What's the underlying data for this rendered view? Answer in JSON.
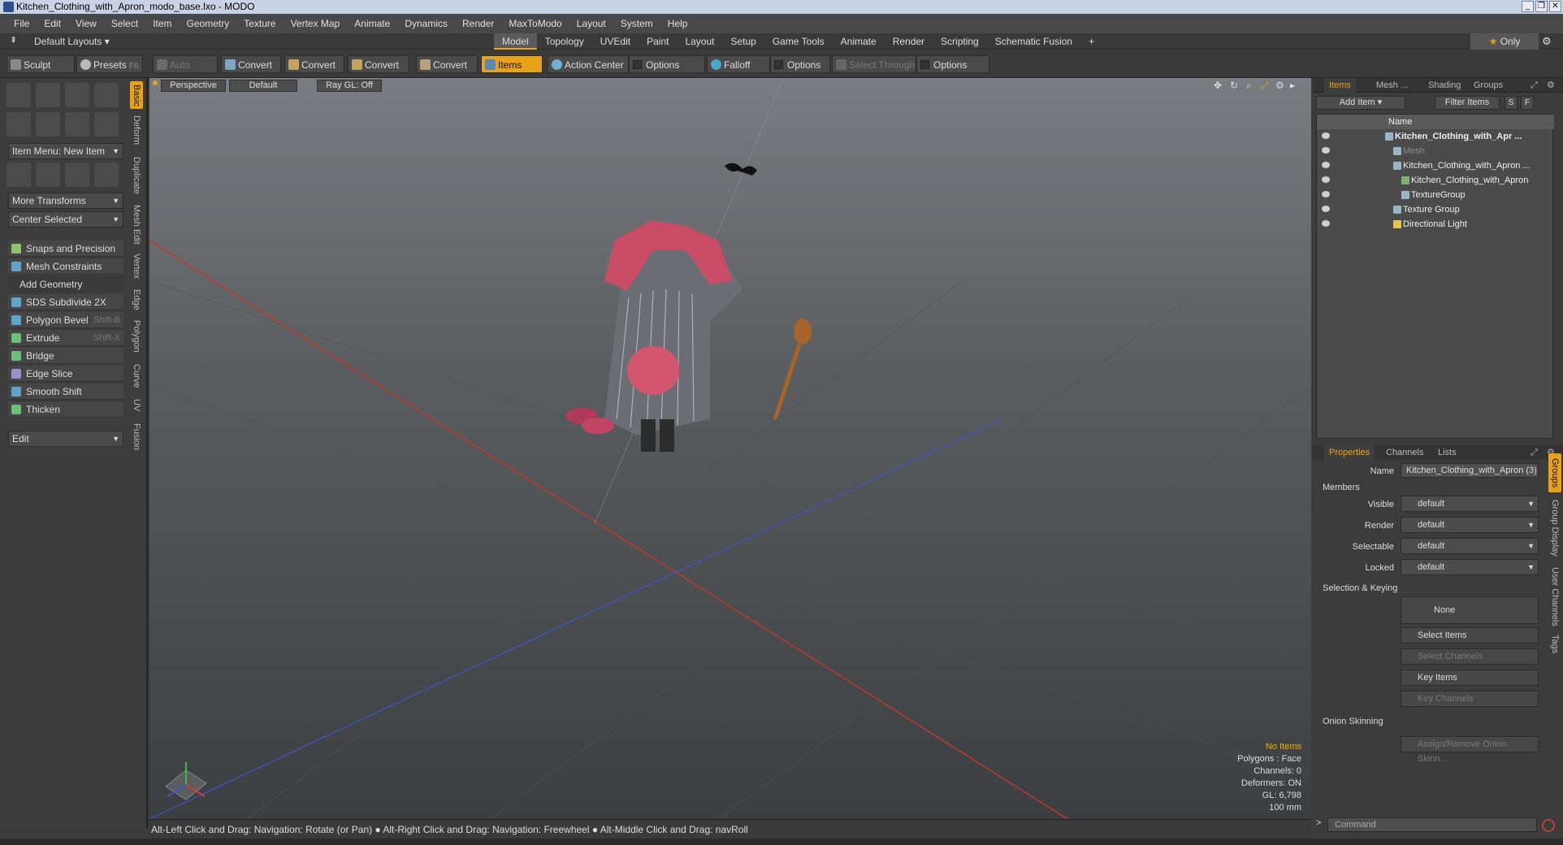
{
  "window": {
    "title": "Kitchen_Clothing_with_Apron_modo_base.lxo - MODO"
  },
  "menubar": [
    "File",
    "Edit",
    "View",
    "Select",
    "Item",
    "Geometry",
    "Texture",
    "Vertex Map",
    "Animate",
    "Dynamics",
    "Render",
    "MaxToModo",
    "Layout",
    "System",
    "Help"
  ],
  "layoutbar": {
    "layout": "Default Layouts",
    "tabs": [
      "Model",
      "Topology",
      "UVEdit",
      "Paint",
      "Layout",
      "Setup",
      "Game Tools",
      "Animate",
      "Render",
      "Scripting",
      "Schematic Fusion"
    ],
    "active_tab": "Model",
    "only": "Only"
  },
  "toolbar": {
    "sculpt": "Sculpt",
    "presets": "Presets",
    "presets_key": "F6",
    "auto_select": "Auto Select",
    "convert": "Convert",
    "items": "Items",
    "action_center": "Action Center",
    "options": "Options",
    "falloff": "Falloff",
    "select_through": "Select Through"
  },
  "left": {
    "item_menu": "Item Menu: New Item",
    "more_transforms": "More Transforms",
    "center_selected": "Center Selected",
    "snaps": "Snaps and Precision",
    "mesh_constraints": "Mesh Constraints",
    "add_geometry": "Add Geometry",
    "tools": [
      {
        "label": "SDS Subdivide 2X",
        "key": ""
      },
      {
        "label": "Polygon Bevel",
        "key": "Shift-B"
      },
      {
        "label": "Extrude",
        "key": "Shift-X"
      },
      {
        "label": "Bridge",
        "key": ""
      },
      {
        "label": "Edge Slice",
        "key": ""
      },
      {
        "label": "Smooth Shift",
        "key": ""
      },
      {
        "label": "Thicken",
        "key": ""
      }
    ],
    "edit": "Edit",
    "vtabs": [
      "Basic",
      "Deform",
      "Duplicate",
      "Mesh Edit",
      "Vertex",
      "Edge",
      "Polygon",
      "Curve",
      "UV",
      "Fusion"
    ]
  },
  "viewport": {
    "view": "Perspective",
    "shading": "Default",
    "raygl": "Ray GL: Off",
    "info": {
      "no_items": "No Items",
      "polygons": "Polygons : Face",
      "channels": "Channels: 0",
      "deformers": "Deformers: ON",
      "gl": "GL: 6,798",
      "scale": "100 mm"
    }
  },
  "status": {
    "text": "Alt-Left Click and Drag: Navigation: Rotate (or Pan) ● Alt-Right Click and Drag: Navigation: Freewheel ● Alt-Middle Click and Drag: navRoll"
  },
  "items_panel": {
    "tabs": [
      "Items",
      "Mesh ...",
      "Shading",
      "Groups"
    ],
    "add_item": "Add Item",
    "filter": "Filter Items",
    "s": "S",
    "f": "F",
    "name_col": "Name",
    "rows": [
      {
        "label": "Kitchen_Clothing_with_Apr ..."
      },
      {
        "label": "Mesh"
      },
      {
        "label": "Kitchen_Clothing_with_Apron ..."
      },
      {
        "label": "Kitchen_Clothing_with_Apron"
      },
      {
        "label": "TextureGroup"
      },
      {
        "label": "Texture Group"
      },
      {
        "label": "Directional Light"
      }
    ]
  },
  "properties": {
    "tabs": [
      "Properties",
      "Channels",
      "Lists"
    ],
    "name_label": "Name",
    "name_value": "Kitchen_Clothing_with_Apron (3)",
    "members": "Members",
    "visible_label": "Visible",
    "render_label": "Render",
    "selectable_label": "Selectable",
    "locked_label": "Locked",
    "default": "default",
    "sel_keying": "Selection & Keying",
    "none": "None",
    "select_items": "Select Items",
    "select_channels": "Select Channels",
    "key_items": "Key Items",
    "key_channels": "Key Channels",
    "onion": "Onion Skinning",
    "assign": "Assign/Remove Onion Skinn...",
    "rvtabs": [
      "Groups",
      "Group Display",
      "User Channels",
      "Tags"
    ],
    "command": "Command"
  }
}
